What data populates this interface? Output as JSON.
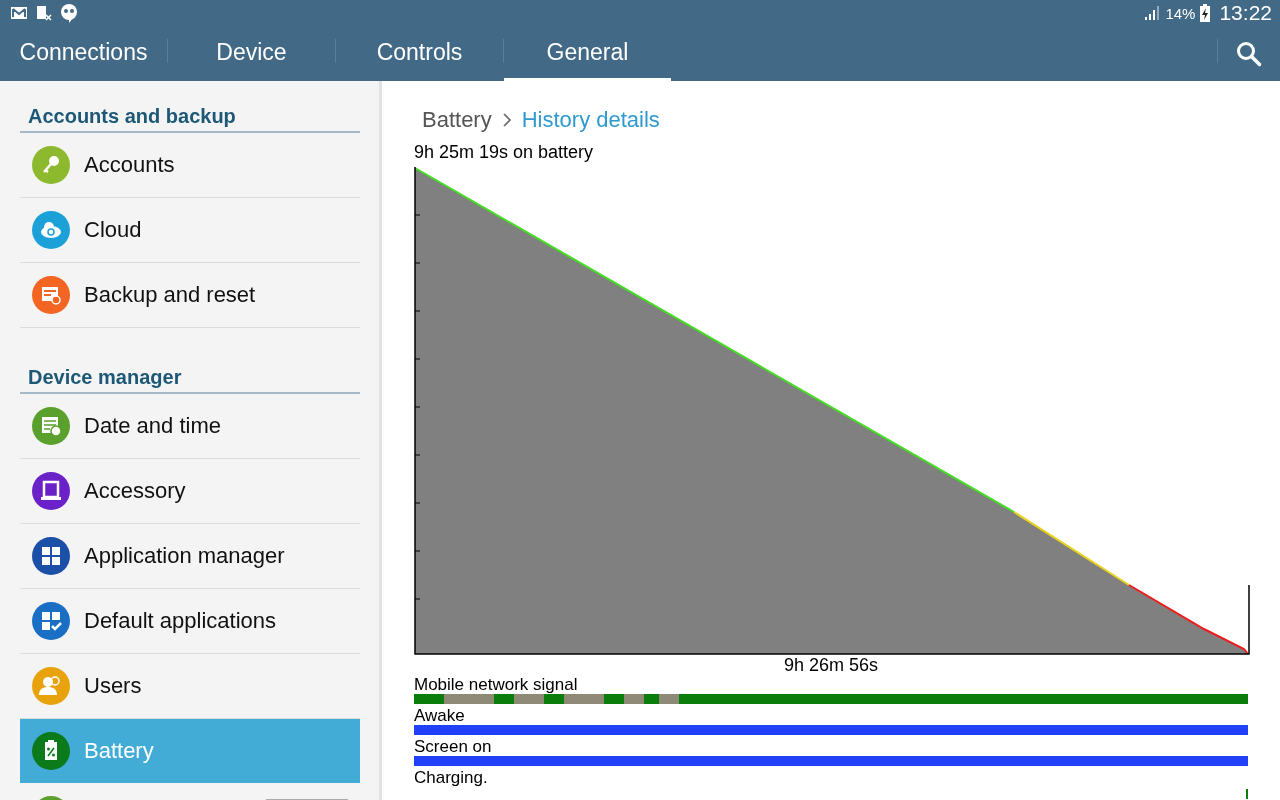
{
  "status_bar": {
    "battery_percent": "14%",
    "time": "13:22"
  },
  "tabs": [
    {
      "label": "Connections",
      "selected": false
    },
    {
      "label": "Device",
      "selected": false
    },
    {
      "label": "Controls",
      "selected": false
    },
    {
      "label": "General",
      "selected": true
    }
  ],
  "sidebar": {
    "sections": [
      {
        "header": "Accounts and backup",
        "items": [
          {
            "label": "Accounts",
            "kind": "key",
            "color": "#8db92e",
            "selected": false
          },
          {
            "label": "Cloud",
            "kind": "cloud",
            "color": "#1ba1d8",
            "selected": false
          },
          {
            "label": "Backup and reset",
            "kind": "backup",
            "color": "#f26522",
            "selected": false
          }
        ]
      },
      {
        "header": "Device manager",
        "items": [
          {
            "label": "Date and time",
            "kind": "calendar",
            "color": "#5aa02c",
            "selected": false
          },
          {
            "label": "Accessory",
            "kind": "accessory",
            "color": "#6a22c8",
            "selected": false
          },
          {
            "label": "Application manager",
            "kind": "grid",
            "color": "#1b4fa8",
            "selected": false
          },
          {
            "label": "Default applications",
            "kind": "gridcheck",
            "color": "#1a6fc4",
            "selected": false
          },
          {
            "label": "Users",
            "kind": "users",
            "color": "#e8a20c",
            "selected": false
          },
          {
            "label": "Battery",
            "kind": "battery",
            "color": "#0a7a1a",
            "selected": true
          },
          {
            "kind": "toggle",
            "color": "#5aa02c",
            "selected": false,
            "on": false
          }
        ]
      }
    ]
  },
  "breadcrumb": {
    "parent": "Battery",
    "current": "History details"
  },
  "history": {
    "duration_label": "9h 25m 19s on battery",
    "time_axis_label": "9h 26m 56s",
    "tracks": [
      {
        "label": "Mobile network signal",
        "kind": "signal"
      },
      {
        "label": "Awake",
        "kind": "blue"
      },
      {
        "label": "Screen on",
        "kind": "blue"
      },
      {
        "label": "Charging.",
        "kind": "charging"
      }
    ]
  }
}
